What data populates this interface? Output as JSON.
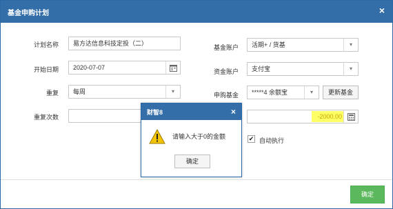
{
  "dialog": {
    "title": "基金申购计划",
    "close_icon": "×"
  },
  "left": {
    "plan_name_label": "计划名称",
    "plan_name_value": "易方达信息科技定投（二）",
    "start_date_label": "开始日期",
    "start_date_value": "2020-07-07",
    "repeat_label": "重复",
    "repeat_value": "每周",
    "repeat_count_label": "重复次数",
    "repeat_count_value": ""
  },
  "right": {
    "fund_account_label": "基金账户",
    "fund_account_value": "活期+ / 货基",
    "cash_account_label": "资金账户",
    "cash_account_value": "支付宝",
    "purchase_fund_label": "申购基金",
    "purchase_fund_value": "*****4 余额宝",
    "update_fund_button": "更新基金",
    "amount_value": "-2000.00",
    "auto_execute_label": "自动执行",
    "auto_execute_checked": true
  },
  "footer": {
    "confirm_button": "确定"
  },
  "popup": {
    "title": "财智8",
    "close_icon": "×",
    "message": "请输入大于0的金额",
    "ok_button": "确定"
  },
  "colors": {
    "titlebar": "#336ea9",
    "confirm_green": "#5cb85c",
    "amount_highlight": "#ffff66"
  }
}
